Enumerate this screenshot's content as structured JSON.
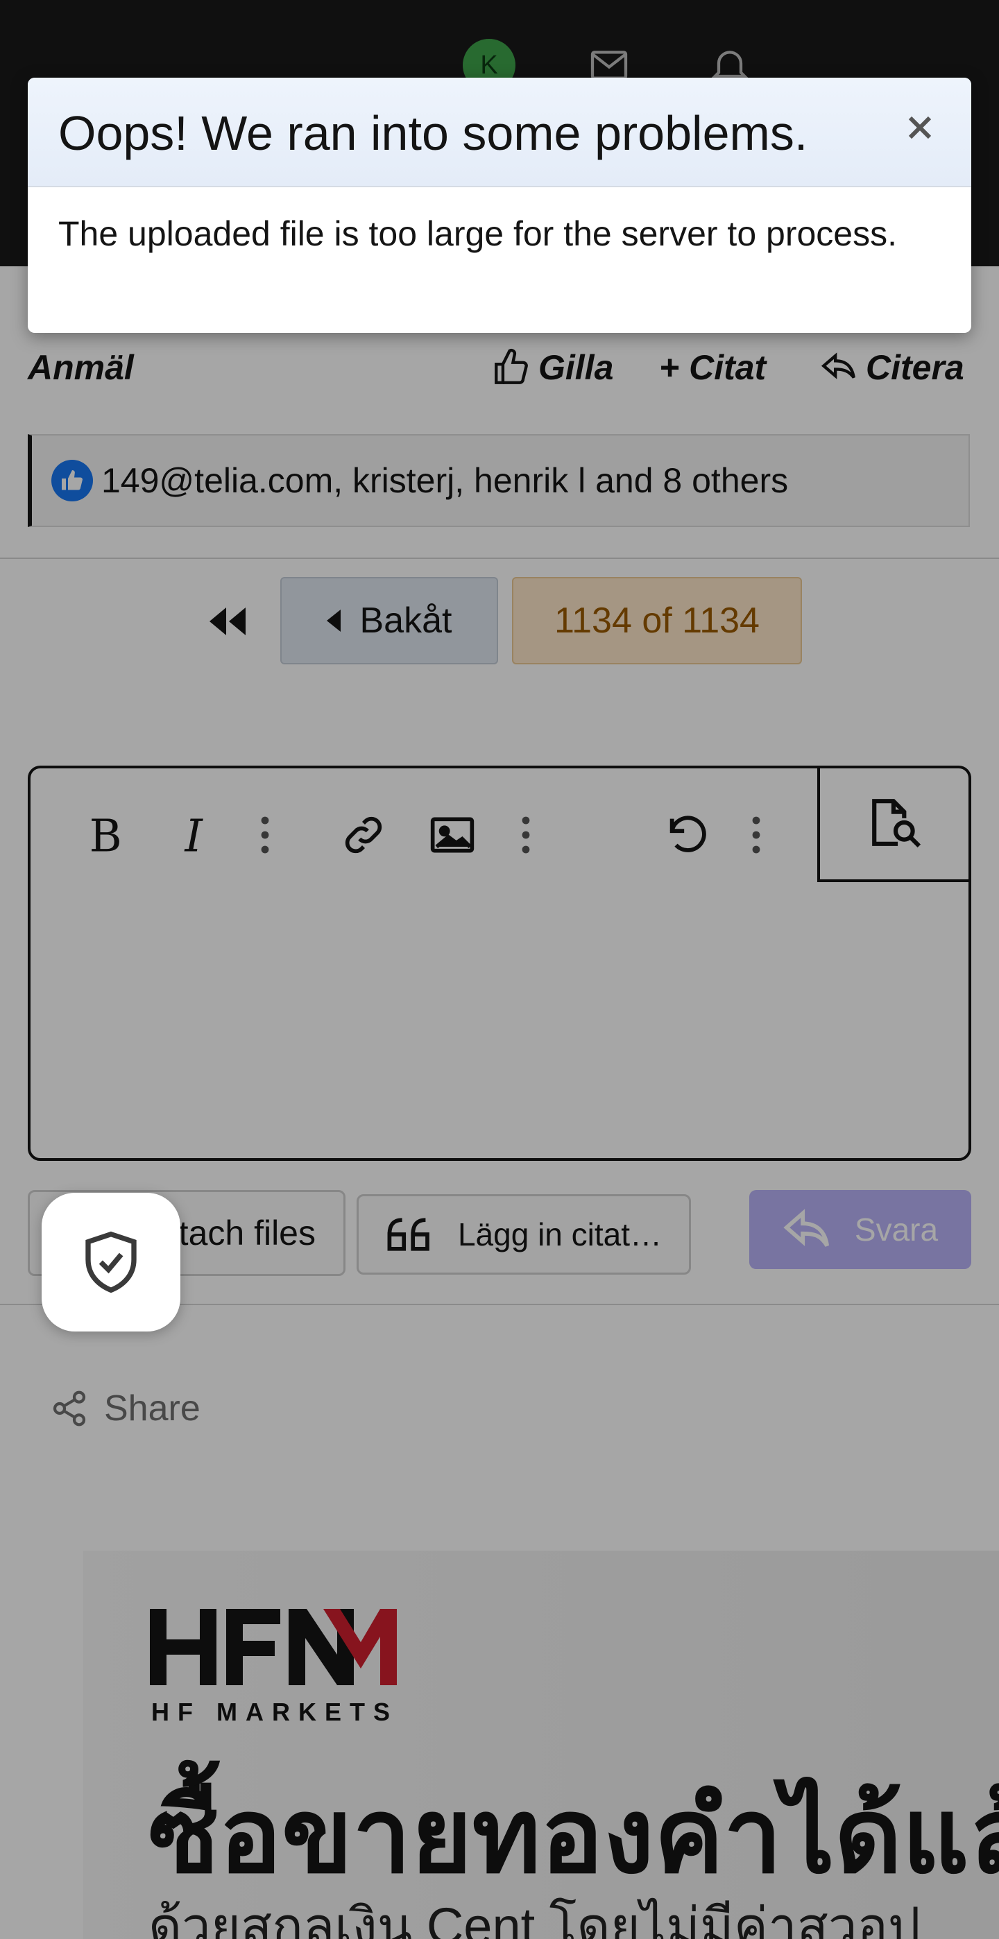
{
  "header": {
    "avatar_letter": "K",
    "icons": [
      "envelope-icon",
      "bell-icon"
    ]
  },
  "post_actions": {
    "report": "Anmäl",
    "like": "Gilla",
    "quote_add": "+ Citat",
    "reply_quote": "Citera"
  },
  "reactions": {
    "text": "149@telia.com, kristerj, henrik l and 8 others"
  },
  "pagination": {
    "back_label": "Bakåt",
    "count_label": "1134 of 1134"
  },
  "editor": {
    "toolbar": [
      "bold-icon",
      "italic-icon",
      "more-icon",
      "link-icon",
      "image-icon",
      "more-icon",
      "undo-icon",
      "more-icon",
      "preview-icon"
    ]
  },
  "actions": {
    "attach_label": "Attach files",
    "insert_quote_label": "Lägg in citat…",
    "reply_label": "Svara"
  },
  "share": {
    "label": "Share"
  },
  "ad": {
    "brand": "HFM",
    "brand_sub": "HF MARKETS",
    "headline": "ซื้อขายทองคำได้แล้ววันนี้",
    "subline": "ด้วยสกุลเงิน Cent โดยไม่มีค่าสวอป",
    "colors": {
      "brand_dark": "#141414",
      "brand_red": "#d0202e"
    }
  },
  "dialog": {
    "title": "Oops! We ran into some problems.",
    "message": "The uploaded file is too large for the server to process."
  },
  "colors": {
    "topbar": "#191919",
    "reply_button": "#b9b2f8",
    "pager_count_bg": "#fde7c9",
    "pager_back_bg": "#dfe6f0",
    "like_badge": "#1877f2"
  }
}
